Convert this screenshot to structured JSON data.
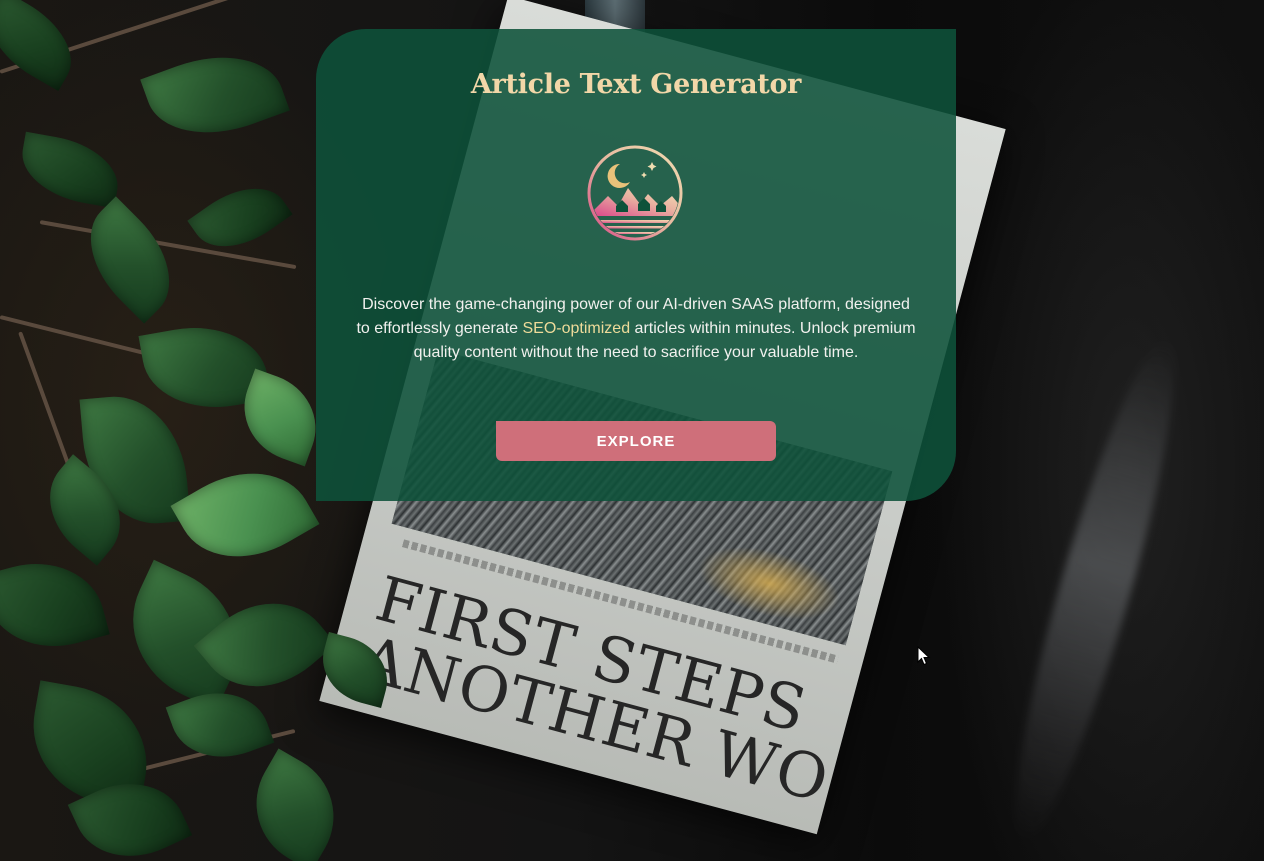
{
  "card": {
    "title": "Article Text Generator",
    "logo_icon": "moon-mountains-logo-icon",
    "description_before": "Discover the game-changing power of our AI-driven SAAS platform, designed to effortlessly generate ",
    "description_highlight": "SEO-optimized",
    "description_after": " articles within minutes. Unlock premium quality content without the need to sacrifice your valuable time.",
    "button_label": "EXPLORE"
  },
  "background": {
    "newspaper_headline_line1": "FIRST STEPS",
    "newspaper_headline_line2": "ANOTHER WO"
  },
  "colors": {
    "card_background": "#0e523a",
    "title": "#f2d7a8",
    "highlight": "#eedb9a",
    "button": "#cf6f7a",
    "button_text": "#ffffff"
  }
}
